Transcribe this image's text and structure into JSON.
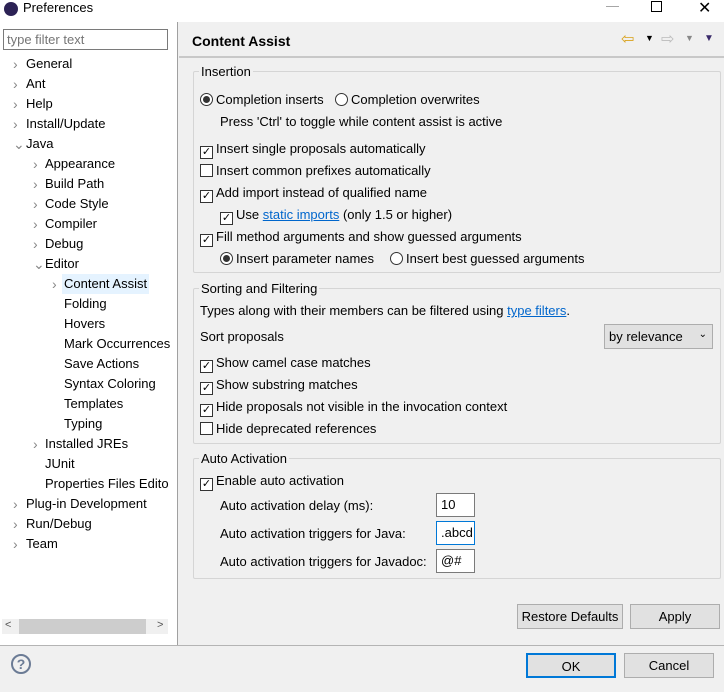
{
  "window": {
    "title": "Preferences",
    "controls": [
      "minimize",
      "maximize",
      "close"
    ]
  },
  "sidebar": {
    "filter_placeholder": "type filter text",
    "items": [
      {
        "label": "General",
        "level": 0,
        "arrow": true
      },
      {
        "label": "Ant",
        "level": 0,
        "arrow": true
      },
      {
        "label": "Help",
        "level": 0,
        "arrow": true
      },
      {
        "label": "Install/Update",
        "level": 0,
        "arrow": true
      },
      {
        "label": "Java",
        "level": 0,
        "arrow": true,
        "expanded": true
      },
      {
        "label": "Appearance",
        "level": 1,
        "arrow": true
      },
      {
        "label": "Build Path",
        "level": 1,
        "arrow": true
      },
      {
        "label": "Code Style",
        "level": 1,
        "arrow": true
      },
      {
        "label": "Compiler",
        "level": 1,
        "arrow": true
      },
      {
        "label": "Debug",
        "level": 1,
        "arrow": true
      },
      {
        "label": "Editor",
        "level": 1,
        "arrow": true,
        "expanded": true
      },
      {
        "label": "Content Assist",
        "level": 2,
        "arrow": true,
        "selected": true
      },
      {
        "label": "Folding",
        "level": 2,
        "arrow": false
      },
      {
        "label": "Hovers",
        "level": 2,
        "arrow": false
      },
      {
        "label": "Mark Occurrences",
        "level": 2,
        "arrow": false
      },
      {
        "label": "Save Actions",
        "level": 2,
        "arrow": false
      },
      {
        "label": "Syntax Coloring",
        "level": 2,
        "arrow": false
      },
      {
        "label": "Templates",
        "level": 2,
        "arrow": false
      },
      {
        "label": "Typing",
        "level": 2,
        "arrow": false
      },
      {
        "label": "Installed JREs",
        "level": 1,
        "arrow": true
      },
      {
        "label": "JUnit",
        "level": 1,
        "arrow": false
      },
      {
        "label": "Properties Files Edito",
        "level": 1,
        "arrow": false
      },
      {
        "label": "Plug-in Development",
        "level": 0,
        "arrow": true
      },
      {
        "label": "Run/Debug",
        "level": 0,
        "arrow": true
      },
      {
        "label": "Team",
        "level": 0,
        "arrow": true
      }
    ]
  },
  "header": {
    "title": "Content Assist"
  },
  "insertion": {
    "label": "Insertion",
    "completion_inserts": "Completion inserts",
    "completion_overwrites": "Completion overwrites",
    "toggle_hint": "Press 'Ctrl' to toggle while content assist is active",
    "single_proposals": "Insert single proposals automatically",
    "common_prefixes": "Insert common prefixes automatically",
    "add_import": "Add import instead of qualified name",
    "use": "Use",
    "static_imports": "static imports",
    "static_suffix": "(only 1.5 or higher)",
    "fill_args": "Fill method arguments and show guessed arguments",
    "param_names": "Insert parameter names",
    "best_guessed": "Insert best guessed arguments"
  },
  "sorting": {
    "label": "Sorting and Filtering",
    "filter_text": "Types along with their members can be filtered using",
    "type_filters": "type filters",
    "period": ".",
    "sort_label": "Sort proposals",
    "sort_value": "by relevance",
    "camel": "Show camel case matches",
    "substring": "Show substring matches",
    "hide_not_visible": "Hide proposals not visible in the invocation context",
    "hide_deprecated": "Hide deprecated references"
  },
  "auto": {
    "label": "Auto Activation",
    "enable": "Enable auto activation",
    "delay_label": "Auto activation delay (ms):",
    "delay_value": "10",
    "java_label": "Auto activation triggers for Java:",
    "java_value": ".abcd",
    "javadoc_label": "Auto activation triggers for Javadoc:",
    "javadoc_value": "@#"
  },
  "buttons": {
    "restore": "Restore Defaults",
    "apply": "Apply",
    "ok": "OK",
    "cancel": "Cancel"
  }
}
